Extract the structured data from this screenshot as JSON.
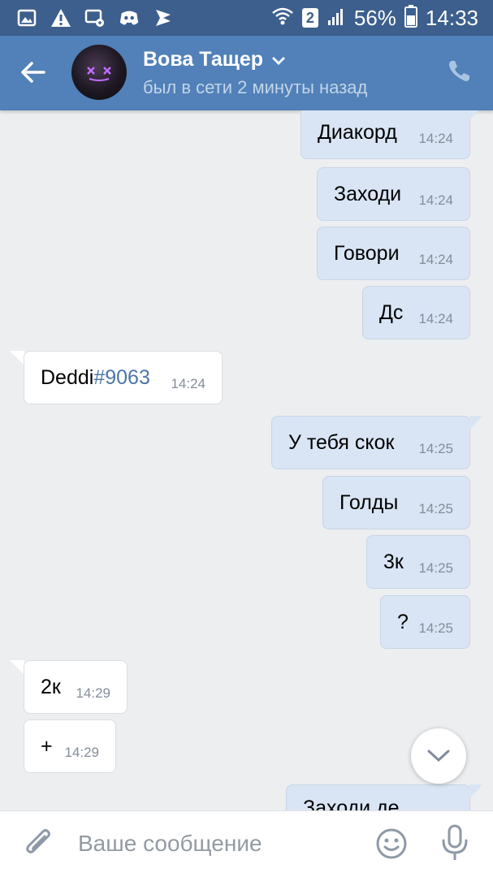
{
  "status_bar": {
    "sim": "2",
    "battery": "56%",
    "time": "14:33",
    "icons": [
      "gallery-icon",
      "warning-icon",
      "cast-icon",
      "discord-icon",
      "vk-play-icon",
      "wifi-icon",
      "signal-icon",
      "battery-icon"
    ]
  },
  "header": {
    "name": "Вова Тащер",
    "status": "был в сети 2 минуты назад"
  },
  "messages": [
    {
      "dir": "out",
      "text": "Диакорд",
      "time": "14:24"
    },
    {
      "dir": "out",
      "text": "Заходи",
      "time": "14:24"
    },
    {
      "dir": "out",
      "text": "Говори",
      "time": "14:24"
    },
    {
      "dir": "out",
      "text": "Дс",
      "time": "14:24"
    },
    {
      "dir": "in",
      "text": "Deddi",
      "hashtag": "#9063",
      "time": "14:24"
    },
    {
      "dir": "out",
      "text": "У тебя скок",
      "time": "14:25"
    },
    {
      "dir": "out",
      "text": "Голды",
      "time": "14:25"
    },
    {
      "dir": "out",
      "text": "3к",
      "time": "14:25"
    },
    {
      "dir": "out",
      "text": "?",
      "time": "14:25"
    },
    {
      "dir": "in",
      "text": "2к",
      "time": "14:29"
    },
    {
      "dir": "in",
      "text": "+",
      "time": "14:29"
    },
    {
      "dir": "out",
      "text": "Заходи де",
      "time": ""
    }
  ],
  "composer": {
    "placeholder": "Ваше сообщение"
  },
  "colors": {
    "statusbar": "#3c5f8d",
    "header": "#5181b8",
    "outgoing_bubble": "#d9e5f4",
    "incoming_bubble": "#ffffff",
    "background": "#edeef0",
    "link": "#4a76a8"
  }
}
